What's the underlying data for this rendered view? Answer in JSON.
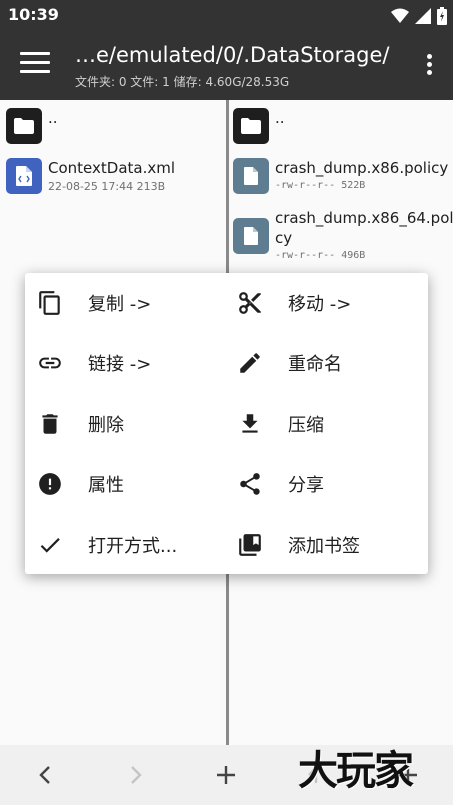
{
  "status_bar": {
    "time": "10:39"
  },
  "app_bar": {
    "path_title": "…e/emulated/0/.DataStorage/",
    "subtitle": "文件夹: 0  文件: 1  储存: 4.60G/28.53G"
  },
  "left_pane": {
    "items": [
      {
        "name": "..",
        "meta": ""
      },
      {
        "name": "ContextData.xml",
        "meta": "22-08-25 17:44  213B"
      }
    ]
  },
  "right_pane": {
    "items": [
      {
        "name": "..",
        "meta": ""
      },
      {
        "name": "crash_dump.x86.policy",
        "meta": "-rw-r--r--  522B"
      },
      {
        "name": "crash_dump.x86_64.poli",
        "name_cont": "cy",
        "meta": "-rw-r--r--  496B"
      }
    ]
  },
  "context_menu": {
    "items": [
      {
        "label": "复制 ->",
        "icon": "copy-icon"
      },
      {
        "label": "移动 ->",
        "icon": "scissors-icon"
      },
      {
        "label": "链接 ->",
        "icon": "link-icon"
      },
      {
        "label": "重命名",
        "icon": "pencil-icon"
      },
      {
        "label": "删除",
        "icon": "trash-icon"
      },
      {
        "label": "压缩",
        "icon": "download-icon"
      },
      {
        "label": "属性",
        "icon": "alert-icon"
      },
      {
        "label": "分享",
        "icon": "share-icon"
      },
      {
        "label": "打开方式...",
        "icon": "check-icon"
      },
      {
        "label": "添加书签",
        "icon": "bookmark-icon"
      }
    ]
  },
  "watermark": {
    "text": "大玩家"
  },
  "colors": {
    "toolbar": "#333333",
    "xml_icon": "#3f63bf",
    "file_icon": "#5f7d91"
  }
}
